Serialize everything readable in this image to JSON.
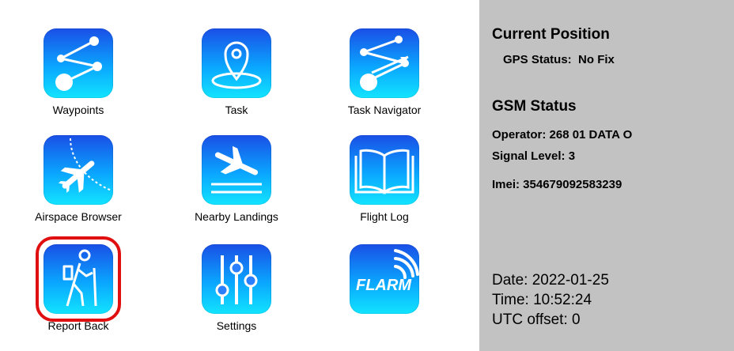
{
  "tiles": [
    {
      "label": "Waypoints",
      "icon": "waypoints-icon",
      "selected": false
    },
    {
      "label": "Task",
      "icon": "map-pin-icon",
      "selected": false
    },
    {
      "label": "Task Navigator",
      "icon": "task-navigator-icon",
      "selected": false
    },
    {
      "label": "Airspace Browser",
      "icon": "airplane-icon",
      "selected": false
    },
    {
      "label": "Nearby Landings",
      "icon": "landing-icon",
      "selected": false
    },
    {
      "label": "Flight Log",
      "icon": "book-icon",
      "selected": false
    },
    {
      "label": "Report Back",
      "icon": "hiker-icon",
      "selected": true
    },
    {
      "label": "Settings",
      "icon": "sliders-icon",
      "selected": false
    },
    {
      "label": "",
      "icon": "flarm-icon",
      "icon_text": "FLARM",
      "selected": false
    }
  ],
  "panel": {
    "position_title": "Current Position",
    "gps_label": "GPS Status:",
    "gps_value": "No Fix",
    "gsm_title": "GSM Status",
    "operator": "Operator: 268 01 DATA O",
    "signal": "Signal Level: 3",
    "imei": "Imei: 354679092583239",
    "date": "Date: 2022-01-25",
    "time": "Time: 10:52:24",
    "utc": "UTC offset: 0"
  },
  "colors": {
    "panel_bg": "#c2c2c2",
    "selection": "#e01010",
    "icon_top": "#1a4fe6",
    "icon_bottom": "#12e4ff"
  }
}
